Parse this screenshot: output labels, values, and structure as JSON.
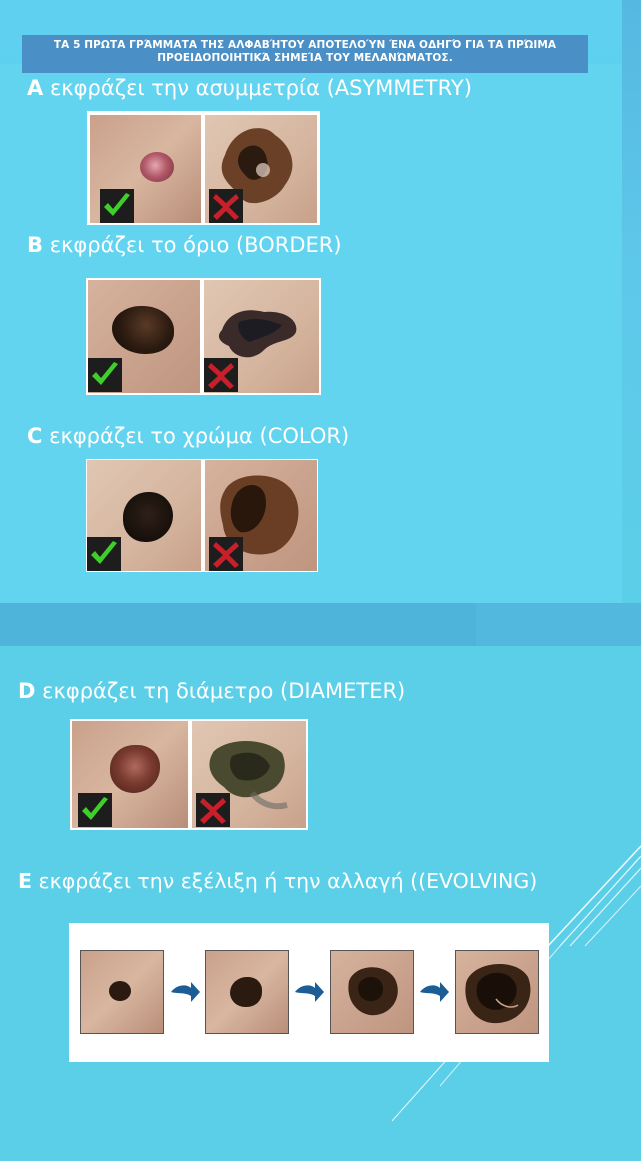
{
  "title": "ΤΑ 5 ΠΡΩΤΑ ΓΡΆΜΜΑΤΑ ΤΗΣ ΑΛΦΑΒΉΤΟΥ ΑΠΟΤΕΛΟΎΝ ΈΝΑ ΟΔΗΓΌ ΓΙΑ ΤΑ ΠΡΏΙΜΑ ΠΡΟΕΙΔΟΠΟΙΗΤΙΚΆ ΣΗΜΕΊΑ ΤΟΥ ΜΕΛΑΝΏΜΑΤΟΣ.",
  "criteria": [
    {
      "letter": "A",
      "text": " εκφράζει την ασυμμετρία (ASYMMETRY)"
    },
    {
      "letter": "B",
      "text": " εκφράζει το όριο (BORDER)"
    },
    {
      "letter": "C",
      "text": " εκφράζει το χρώμα (COLOR)"
    },
    {
      "letter": "D",
      "text": " εκφράζει τη διάμετρο (DIAMETER)"
    },
    {
      "letter": "E",
      "text": " εκφράζει την εξέλιξη ή την αλλαγή ((EVOLVING)"
    }
  ],
  "icons": {
    "good": "checkmark-icon",
    "bad": "cross-icon",
    "step": "arrow-right-icon"
  },
  "colors": {
    "background": "#5ccfe8",
    "title_bar": "#4a90c6",
    "check": "#3fcf2a",
    "cross": "#c8202a",
    "arrow": "#1d5d96"
  }
}
